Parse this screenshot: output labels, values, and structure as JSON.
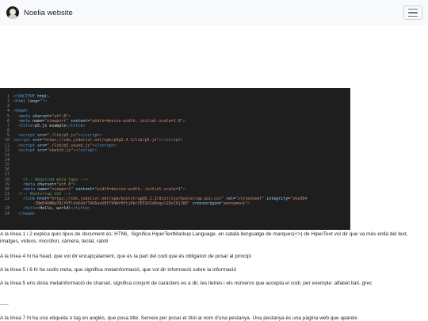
{
  "navbar": {
    "brand": "Noelia website",
    "toggle_icon": "hamburger-menu-icon",
    "logo_icon": "avatar-logo-icon",
    "background": "#f8f9fa"
  },
  "code": {
    "background": "#1e1e1e",
    "lines": [
      {
        "n": "1",
        "parts": [
          {
            "c": "p",
            "t": "<!"
          },
          {
            "c": "t",
            "t": "DOCTYPE"
          },
          {
            "c": "a",
            "t": " html"
          },
          {
            "c": "p",
            "t": ">"
          }
        ]
      },
      {
        "n": "2",
        "parts": [
          {
            "c": "p",
            "t": "<"
          },
          {
            "c": "t",
            "t": "html"
          },
          {
            "c": "",
            "t": " "
          },
          {
            "c": "a",
            "t": "lang"
          },
          {
            "c": "",
            "t": "="
          },
          {
            "c": "s",
            "t": "\"\""
          },
          {
            "c": "p",
            "t": ">"
          }
        ]
      },
      {
        "n": "3",
        "parts": []
      },
      {
        "n": "4",
        "parts": [
          {
            "c": "p",
            "t": "<"
          },
          {
            "c": "t",
            "t": "head"
          },
          {
            "c": "p",
            "t": ">"
          }
        ]
      },
      {
        "n": "5",
        "parts": [
          {
            "c": "",
            "t": "  "
          },
          {
            "c": "p",
            "t": "<"
          },
          {
            "c": "t",
            "t": "meta"
          },
          {
            "c": "",
            "t": " "
          },
          {
            "c": "a",
            "t": "charset"
          },
          {
            "c": "",
            "t": "="
          },
          {
            "c": "s",
            "t": "\"utf-8\""
          },
          {
            "c": "p",
            "t": ">"
          }
        ]
      },
      {
        "n": "6",
        "parts": [
          {
            "c": "",
            "t": "  "
          },
          {
            "c": "p",
            "t": "<"
          },
          {
            "c": "t",
            "t": "meta"
          },
          {
            "c": "",
            "t": " "
          },
          {
            "c": "a",
            "t": "name"
          },
          {
            "c": "",
            "t": "="
          },
          {
            "c": "s",
            "t": "\"viewport\""
          },
          {
            "c": "",
            "t": " "
          },
          {
            "c": "a",
            "t": "content"
          },
          {
            "c": "",
            "t": "="
          },
          {
            "c": "s",
            "t": "\"width=device-width, initial-scale=1.0\""
          },
          {
            "c": "p",
            "t": ">"
          }
        ]
      },
      {
        "n": "7",
        "parts": [
          {
            "c": "",
            "t": "  "
          },
          {
            "c": "p",
            "t": "<"
          },
          {
            "c": "t",
            "t": "title"
          },
          {
            "c": "p",
            "t": ">"
          },
          {
            "c": "",
            "t": "p5.js example"
          },
          {
            "c": "p",
            "t": "</"
          },
          {
            "c": "t",
            "t": "title"
          },
          {
            "c": "p",
            "t": ">"
          }
        ]
      },
      {
        "n": "8",
        "parts": []
      },
      {
        "n": "9",
        "parts": [
          {
            "c": "",
            "t": "  "
          },
          {
            "c": "p",
            "t": "<"
          },
          {
            "c": "t",
            "t": "script"
          },
          {
            "c": "",
            "t": " "
          },
          {
            "c": "a",
            "t": "src"
          },
          {
            "c": "",
            "t": "="
          },
          {
            "c": "s",
            "t": "\"./lib/p5.js\""
          },
          {
            "c": "p",
            "t": "></"
          },
          {
            "c": "t",
            "t": "script"
          },
          {
            "c": "p",
            "t": ">"
          }
        ]
      },
      {
        "n": "10",
        "parts": [
          {
            "c": "p",
            "t": "<"
          },
          {
            "c": "t",
            "t": "script"
          },
          {
            "c": "",
            "t": " "
          },
          {
            "c": "a",
            "t": "src"
          },
          {
            "c": "",
            "t": "="
          },
          {
            "c": "s",
            "t": "\"https://cdn.jsdelivr.net/npm/p5@1.4.1/lib/p5.js\""
          },
          {
            "c": "p",
            "t": "></"
          },
          {
            "c": "t",
            "t": "script"
          },
          {
            "c": "p",
            "t": ">"
          }
        ]
      },
      {
        "n": "11",
        "parts": [
          {
            "c": "",
            "t": "  "
          },
          {
            "c": "p",
            "t": "<"
          },
          {
            "c": "t",
            "t": "script"
          },
          {
            "c": "",
            "t": " "
          },
          {
            "c": "a",
            "t": "src"
          },
          {
            "c": "",
            "t": "="
          },
          {
            "c": "s",
            "t": "\"./lib/p5.sound.js\""
          },
          {
            "c": "p",
            "t": "></"
          },
          {
            "c": "t",
            "t": "script"
          },
          {
            "c": "p",
            "t": ">"
          }
        ]
      },
      {
        "n": "12",
        "parts": [
          {
            "c": "",
            "t": "  "
          },
          {
            "c": "p",
            "t": "<"
          },
          {
            "c": "t",
            "t": "script"
          },
          {
            "c": "",
            "t": " "
          },
          {
            "c": "a",
            "t": "src"
          },
          {
            "c": "",
            "t": "="
          },
          {
            "c": "s",
            "t": "\"sketch.js\""
          },
          {
            "c": "p",
            "t": "></"
          },
          {
            "c": "t",
            "t": "script"
          },
          {
            "c": "p",
            "t": ">"
          }
        ]
      },
      {
        "n": "13",
        "parts": []
      },
      {
        "n": "14",
        "parts": []
      },
      {
        "n": "15",
        "parts": []
      },
      {
        "n": "16",
        "parts": []
      },
      {
        "n": "17",
        "parts": []
      },
      {
        "n": "18",
        "parts": [
          {
            "c": "",
            "t": "    "
          },
          {
            "c": "c",
            "t": "<!-- Required meta tags -->"
          }
        ]
      },
      {
        "n": "19",
        "parts": [
          {
            "c": "",
            "t": "    "
          },
          {
            "c": "p",
            "t": "<"
          },
          {
            "c": "t",
            "t": "meta"
          },
          {
            "c": "",
            "t": " "
          },
          {
            "c": "a",
            "t": "charset"
          },
          {
            "c": "",
            "t": "="
          },
          {
            "c": "s",
            "t": "\"utf-8\""
          },
          {
            "c": "p",
            "t": ">"
          }
        ]
      },
      {
        "n": "20",
        "parts": [
          {
            "c": "",
            "t": "    "
          },
          {
            "c": "p",
            "t": "<"
          },
          {
            "c": "t",
            "t": "meta"
          },
          {
            "c": "",
            "t": " "
          },
          {
            "c": "a",
            "t": "name"
          },
          {
            "c": "",
            "t": "="
          },
          {
            "c": "s",
            "t": "\"viewport\""
          },
          {
            "c": "",
            "t": " "
          },
          {
            "c": "a",
            "t": "content"
          },
          {
            "c": "",
            "t": "="
          },
          {
            "c": "s",
            "t": "\"width=device-width, initial-scale=1\""
          },
          {
            "c": "p",
            "t": ">"
          }
        ]
      },
      {
        "n": "21",
        "parts": [
          {
            "c": "",
            "t": "  "
          },
          {
            "c": "c",
            "t": "<!-- Bootstrap CSS -->"
          }
        ]
      },
      {
        "n": "22",
        "parts": [
          {
            "c": "",
            "t": "    "
          },
          {
            "c": "p",
            "t": "<"
          },
          {
            "c": "t",
            "t": "link"
          },
          {
            "c": "",
            "t": " "
          },
          {
            "c": "a",
            "t": "href"
          },
          {
            "c": "",
            "t": "="
          },
          {
            "c": "s",
            "t": "\"https://cdn.jsdelivr.net/npm/bootstrap@5.1.3/dist/css/bootstrap.min.css\""
          },
          {
            "c": "",
            "t": " "
          },
          {
            "c": "a",
            "t": "rel"
          },
          {
            "c": "",
            "t": "="
          },
          {
            "c": "s",
            "t": "\"stylesheet\""
          },
          {
            "c": "",
            "t": " "
          },
          {
            "c": "a",
            "t": "integrity"
          },
          {
            "c": "",
            "t": "="
          },
          {
            "c": "s",
            "t": "\"sha384"
          }
        ]
      },
      {
        "n": "",
        "parts": [
          {
            "c": "s",
            "t": "        -1BmE4kWBq78iYhFldvKuhfTAU6auU8tT94WrHftjDbrCEXSU1oBoqyl2QvZ6jIW3\""
          },
          {
            "c": "",
            "t": " "
          },
          {
            "c": "a",
            "t": "crossorigin"
          },
          {
            "c": "",
            "t": "="
          },
          {
            "c": "s",
            "t": "\"anonymous\""
          },
          {
            "c": "p",
            "t": ">"
          }
        ]
      },
      {
        "n": "23",
        "parts": [
          {
            "c": "",
            "t": "    "
          },
          {
            "c": "p",
            "t": "<"
          },
          {
            "c": "t",
            "t": "title"
          },
          {
            "c": "p",
            "t": ">"
          },
          {
            "c": "",
            "t": "Hello, world!"
          },
          {
            "c": "p",
            "t": "</"
          },
          {
            "c": "t",
            "t": "title"
          },
          {
            "c": "p",
            "t": ">"
          }
        ]
      },
      {
        "n": "24",
        "parts": [
          {
            "c": "",
            "t": "  "
          },
          {
            "c": "p",
            "t": "</"
          },
          {
            "c": "t",
            "t": "head"
          },
          {
            "c": "p",
            "t": ">"
          }
        ]
      }
    ]
  },
  "paragraphs": {
    "p1": "A la línea 1 i 2 explica quin tipus de document és: HTML. Significa HiperTextMarkup Language, en català llenguatge de marques(<>) de HiperText vol dir que va més enllà del text, imatges, vídeos, micròfon, càmera, teclat, ratolí",
    "p2": "A la línea 4 hi ha head, que vol dir encapçalament, que és la part del codi que és obligatori de posar al principi",
    "p3": "A la línea 5 i 6 hi ha codis meta, que significa metainformació, que vol dir informació sobre la informació",
    "p4": "A la línea 5 ens dona metainformació de charset, significa conjunt de caràcters es a dir, les lletres i els números que accepta el codi, per exemple: alfabet llatí, grec",
    "p5": "-----",
    "p6": "A la línea 7 hi ha una etiqueta o tag en anglès, que posa title. Serveix per posar el títol al nom d'una pestanya. Una pestanya és una pàgina web que apareix"
  }
}
